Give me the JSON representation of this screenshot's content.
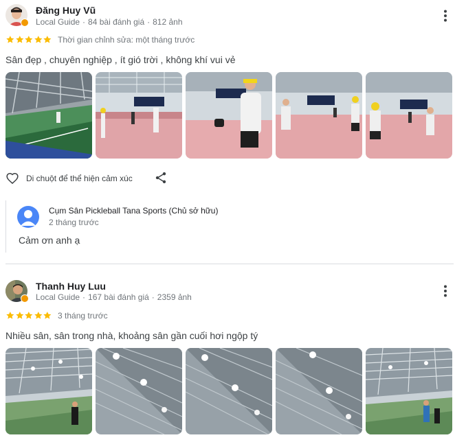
{
  "reviews": [
    {
      "name": "Đăng Huy Vũ",
      "local_guide": "Local Guide",
      "reviews_count": "84 bài đánh giá",
      "photos_count": "812 ảnh",
      "rating": 5,
      "rating_note": "Thời gian chỉnh sửa: một tháng trước",
      "text": "Sân đẹp , chuyên nghiệp , ít gió trời , không khí vui vẻ",
      "reaction_hint": "Di chuột để thể hiện cảm xúc",
      "owner_reply": {
        "name": "Cụm Sân Pickleball Tana Sports (Chủ sở hữu)",
        "time": "2 tháng trước",
        "text": "Cảm ơn anh ạ"
      }
    },
    {
      "name": "Thanh Huy Luu",
      "local_guide": "Local Guide",
      "reviews_count": "167 bài đánh giá",
      "photos_count": "2359 ảnh",
      "rating": 5,
      "rating_note": "3 tháng trước",
      "text": "Nhiều sân, sân trong nhà, khoảng sân gần cuối hơi ngộp tý"
    }
  ],
  "icons": {
    "more": "more-vert-icon",
    "heart": "heart-outline-icon",
    "share": "share-icon",
    "star": "star-filled-icon",
    "badge": "local-guide-badge-icon"
  },
  "colors": {
    "star": "#fbbc04",
    "badge": "#f29900",
    "owner_avatar": "#4a86f7",
    "muted_text": "#70757a",
    "divider": "#dadce0"
  }
}
